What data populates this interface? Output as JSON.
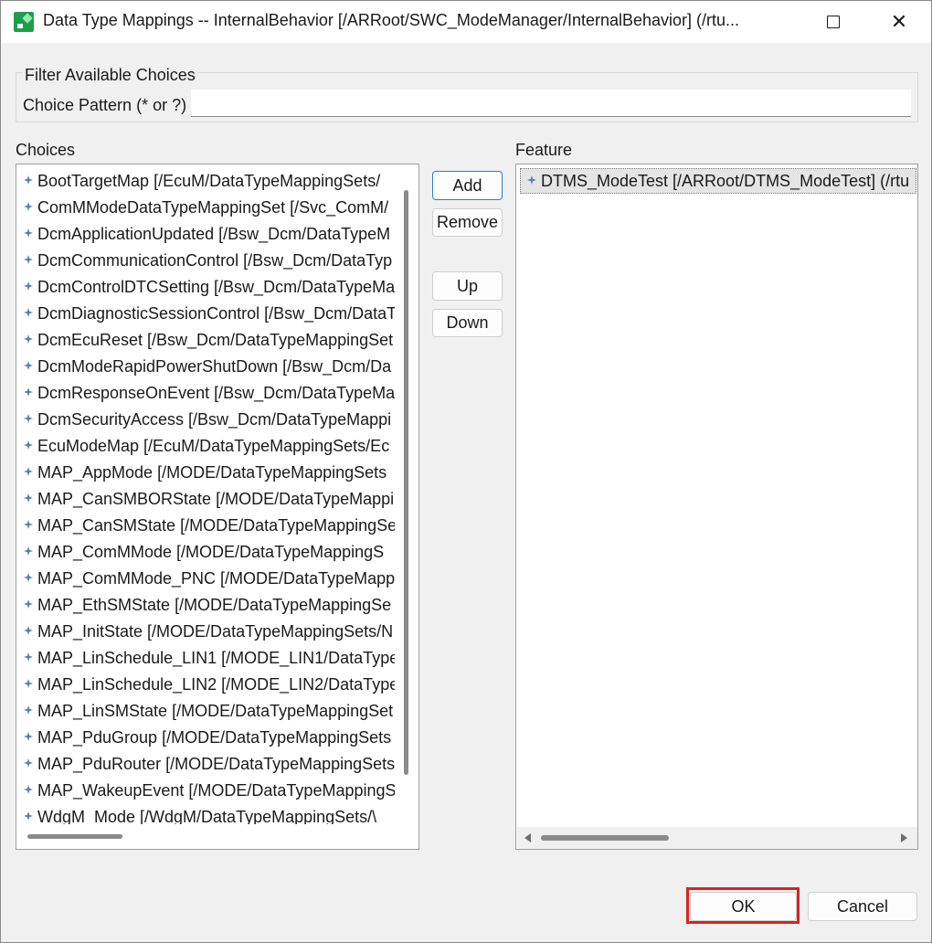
{
  "window": {
    "title": "Data Type Mappings -- InternalBehavior [/ARRoot/SWC_ModeManager/InternalBehavior] (/rtu..."
  },
  "filter": {
    "legend": "Filter Available Choices",
    "pattern_label": "Choice Pattern (* or ?)",
    "pattern_value": ""
  },
  "choices": {
    "label": "Choices",
    "items": [
      "BootTargetMap [/EcuM/DataTypeMappingSets/",
      "ComMModeDataTypeMappingSet [/Svc_ComM/",
      "DcmApplicationUpdated [/Bsw_Dcm/DataTypeM",
      "DcmCommunicationControl [/Bsw_Dcm/DataTyp",
      "DcmControlDTCSetting [/Bsw_Dcm/DataTypeMa",
      "DcmDiagnosticSessionControl [/Bsw_Dcm/DataT",
      "DcmEcuReset [/Bsw_Dcm/DataTypeMappingSet",
      "DcmModeRapidPowerShutDown [/Bsw_Dcm/Da",
      "DcmResponseOnEvent [/Bsw_Dcm/DataTypeMa",
      "DcmSecurityAccess [/Bsw_Dcm/DataTypeMappi",
      "EcuModeMap [/EcuM/DataTypeMappingSets/Ec",
      "MAP_AppMode [/MODE/DataTypeMappingSets",
      "MAP_CanSMBORState [/MODE/DataTypeMappi",
      "MAP_CanSMState [/MODE/DataTypeMappingSe",
      "MAP_ComMMode [/MODE/DataTypeMappingS",
      "MAP_ComMMode_PNC [/MODE/DataTypeMapp",
      "MAP_EthSMState [/MODE/DataTypeMappingSe",
      "MAP_InitState [/MODE/DataTypeMappingSets/N",
      "MAP_LinSchedule_LIN1 [/MODE_LIN1/DataType",
      "MAP_LinSchedule_LIN2 [/MODE_LIN2/DataType",
      "MAP_LinSMState [/MODE/DataTypeMappingSet",
      "MAP_PduGroup [/MODE/DataTypeMappingSets",
      "MAP_PduRouter [/MODE/DataTypeMappingSets",
      "MAP_WakeupEvent [/MODE/DataTypeMappingS",
      "WdgM_Mode [/WdgM/DataTypeMappingSets/\\"
    ]
  },
  "buttons": {
    "add": "Add",
    "remove": "Remove",
    "up": "Up",
    "down": "Down",
    "ok": "OK",
    "cancel": "Cancel"
  },
  "feature": {
    "label": "Feature",
    "items": [
      "DTMS_ModeTest [/ARRoot/DTMS_ModeTest] (/rtu"
    ]
  },
  "icons": {
    "item_icon": "mapping-diamond-icon",
    "app_icon": "app-logo-icon",
    "maximize": "maximize-icon",
    "close": "close-icon"
  },
  "colors": {
    "highlight": "#e02020",
    "default_button_border": "#2f7bd1",
    "item_icon": "#5a7fb0"
  }
}
